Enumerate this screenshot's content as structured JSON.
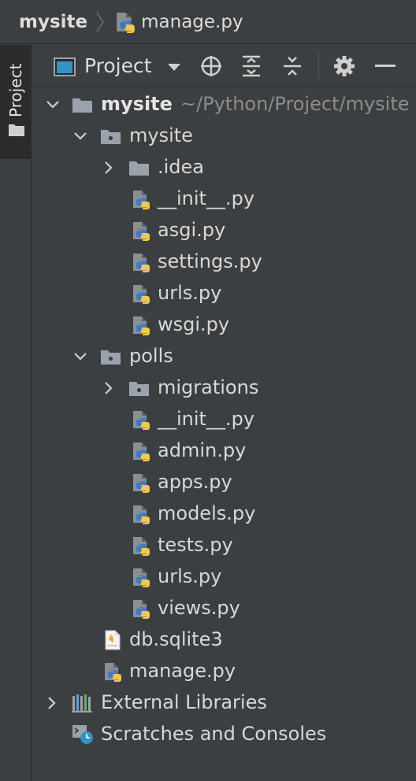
{
  "breadcrumb": {
    "root": "mysite",
    "file": "manage.py"
  },
  "toolwindow": {
    "tab_label": "Project"
  },
  "toolbar": {
    "title": "Project",
    "icons": [
      "locate-icon",
      "expand-all-icon",
      "collapse-all-icon",
      "gear-icon",
      "minimize-icon"
    ]
  },
  "tree": {
    "root": {
      "name": "mysite",
      "path": "~/Python/Project/mysite"
    },
    "mysite_pkg": {
      "name": "mysite"
    },
    "idea": {
      "name": ".idea"
    },
    "mysite_files": [
      "__init__.py",
      "asgi.py",
      "settings.py",
      "urls.py",
      "wsgi.py"
    ],
    "polls_pkg": {
      "name": "polls"
    },
    "migrations": {
      "name": "migrations"
    },
    "polls_files": [
      "__init__.py",
      "admin.py",
      "apps.py",
      "models.py",
      "tests.py",
      "urls.py",
      "views.py"
    ],
    "db": {
      "name": "db.sqlite3"
    },
    "manage": {
      "name": "manage.py"
    },
    "external": {
      "name": "External Libraries"
    },
    "scratches": {
      "name": "Scratches and Consoles"
    }
  }
}
